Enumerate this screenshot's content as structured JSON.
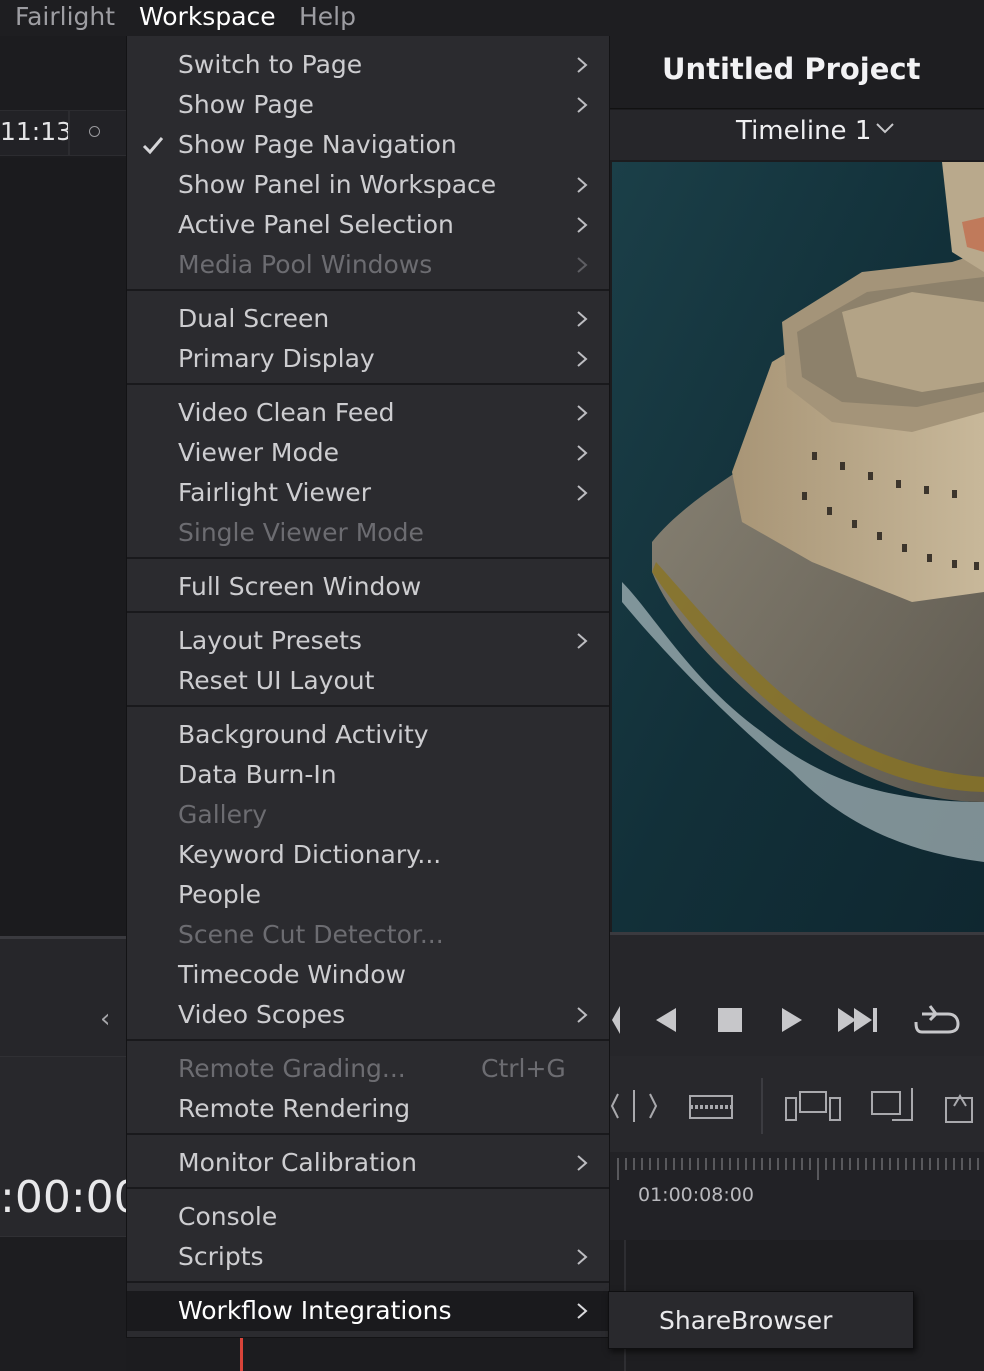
{
  "menubar": {
    "items": [
      "Fairlight",
      "Workspace",
      "Help"
    ]
  },
  "left": {
    "timecode": "11:13",
    "big_timecode": ":00:00"
  },
  "project": {
    "title": "Untitled Project",
    "timeline": "Timeline 1"
  },
  "ruler": {
    "timecode": "01:00:08:00"
  },
  "menu": {
    "items": [
      {
        "label": "Switch to Page",
        "submenu": true
      },
      {
        "label": "Show Page",
        "submenu": true
      },
      {
        "label": "Show Page Navigation",
        "checked": true
      },
      {
        "label": "Show Panel in Workspace",
        "submenu": true
      },
      {
        "label": "Active Panel Selection",
        "submenu": true
      },
      {
        "label": "Media Pool Windows",
        "submenu": true,
        "disabled": true
      },
      {
        "label": "Dual Screen",
        "submenu": true
      },
      {
        "label": "Primary Display",
        "submenu": true
      },
      {
        "label": "Video Clean Feed",
        "submenu": true
      },
      {
        "label": "Viewer Mode",
        "submenu": true
      },
      {
        "label": "Fairlight Viewer",
        "submenu": true
      },
      {
        "label": "Single Viewer Mode",
        "disabled": true
      },
      {
        "label": "Full Screen Window"
      },
      {
        "label": "Layout Presets",
        "submenu": true
      },
      {
        "label": "Reset UI Layout"
      },
      {
        "label": "Background Activity"
      },
      {
        "label": "Data Burn-In"
      },
      {
        "label": "Gallery",
        "disabled": true
      },
      {
        "label": "Keyword Dictionary..."
      },
      {
        "label": "People"
      },
      {
        "label": "Scene Cut Detector...",
        "disabled": true
      },
      {
        "label": "Timecode Window"
      },
      {
        "label": "Video Scopes",
        "submenu": true
      },
      {
        "label": "Remote Grading...",
        "disabled": true,
        "shortcut": "Ctrl+G"
      },
      {
        "label": "Remote Rendering"
      },
      {
        "label": "Monitor Calibration",
        "submenu": true
      },
      {
        "label": "Console"
      },
      {
        "label": "Scripts",
        "submenu": true
      },
      {
        "label": "Workflow Integrations",
        "submenu": true,
        "highlighted": true
      }
    ]
  },
  "submenu": {
    "items": [
      "ShareBrowser"
    ]
  },
  "colors": {
    "menu_bg": "#2b2b2f",
    "highlight_bg": "#1a1a1d",
    "text": "#cdcdd0",
    "disabled_text": "#6c6c71",
    "playhead": "#d8443a"
  }
}
